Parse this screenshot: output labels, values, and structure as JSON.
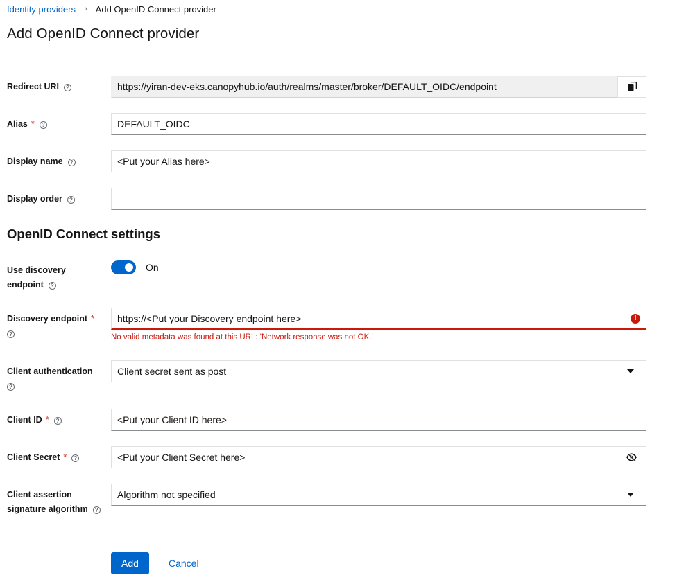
{
  "breadcrumb": {
    "parent": "Identity providers",
    "separator": "›",
    "current": "Add OpenID Connect provider"
  },
  "page": {
    "title": "Add OpenID Connect provider"
  },
  "general": {
    "redirect_uri": {
      "label": "Redirect URI",
      "value": "https://yiran-dev-eks.canopyhub.io/auth/realms/master/broker/DEFAULT_OIDC/endpoint",
      "copy_icon": "copy-icon"
    },
    "alias": {
      "label": "Alias",
      "required": "*",
      "value": "DEFAULT_OIDC"
    },
    "display_name": {
      "label": "Display name",
      "value": "<Put your Alias here>"
    },
    "display_order": {
      "label": "Display order",
      "value": ""
    }
  },
  "oidc": {
    "section_title": "OpenID Connect settings",
    "discovery_toggle": {
      "label_line1": "Use discovery",
      "label_line2": "endpoint",
      "state": "On",
      "enabled": true
    },
    "discovery_endpoint": {
      "label": "Discovery endpoint",
      "required": "*",
      "value": "https://<Put your Discovery endpoint here>",
      "error": "No valid metadata was found at this URL: 'Network response was not OK.'"
    },
    "client_authentication": {
      "label": "Client authentication",
      "selected": "Client secret sent as post"
    },
    "client_id": {
      "label": "Client ID",
      "required": "*",
      "value": "<Put your Client ID here>"
    },
    "client_secret": {
      "label": "Client Secret",
      "required": "*",
      "value": "<Put your Client Secret here>",
      "toggle_icon": "eye-slash-icon"
    },
    "assertion_algorithm": {
      "label_line1": "Client assertion",
      "label_line2": "signature algorithm",
      "selected": "Algorithm not specified"
    }
  },
  "actions": {
    "add": "Add",
    "cancel": "Cancel"
  },
  "colors": {
    "primary": "#0066cc",
    "danger": "#c9190b",
    "text": "#151515",
    "border": "#d2d2d2"
  },
  "help_glyph": "?"
}
